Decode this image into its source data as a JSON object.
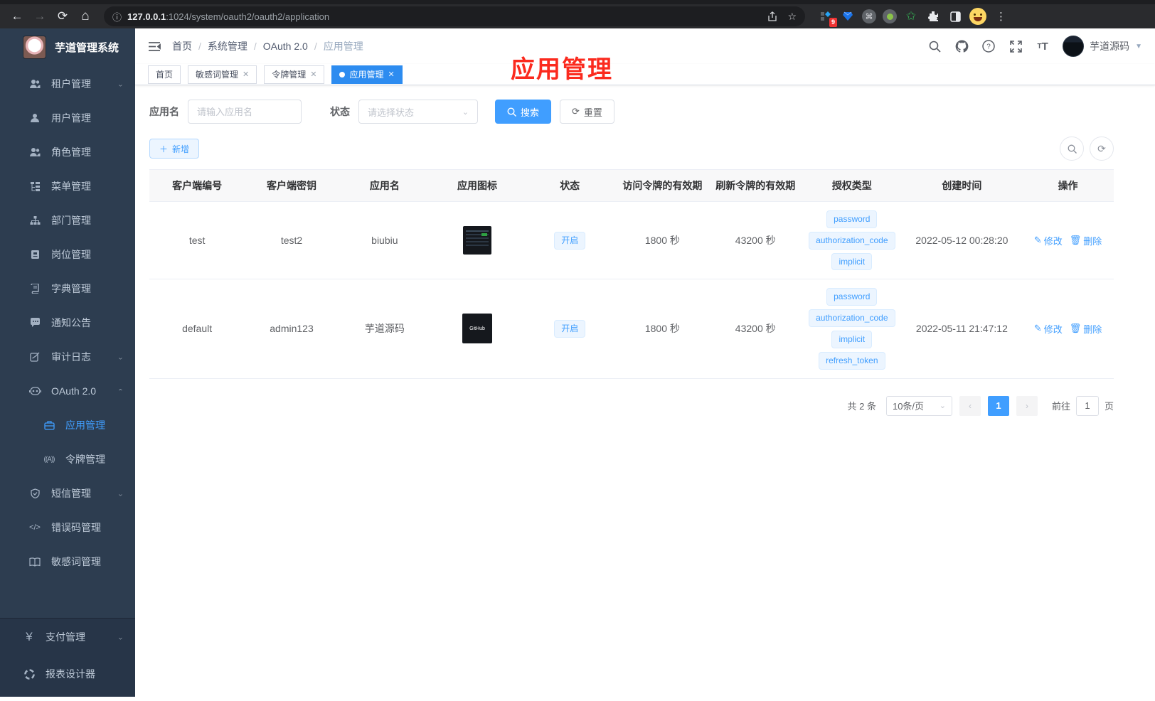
{
  "browser": {
    "url_host": "127.0.0.1",
    "url_rest": ":1024/system/oauth2/oauth2/application",
    "extension_badge": "9"
  },
  "sidebar": {
    "title": "芋道管理系统",
    "items": {
      "tenant": "租户管理",
      "user": "用户管理",
      "role": "角色管理",
      "menu": "菜单管理",
      "dept": "部门管理",
      "post": "岗位管理",
      "dict": "字典管理",
      "notice": "通知公告",
      "audit": "审计日志",
      "oauth": "OAuth 2.0",
      "oauth_app": "应用管理",
      "oauth_token": "令牌管理",
      "sms": "短信管理",
      "errcode": "错误码管理",
      "sensitive": "敏感词管理",
      "pay": "支付管理",
      "report": "报表设计器"
    }
  },
  "header": {
    "breadcrumb": [
      "首页",
      "系统管理",
      "OAuth 2.0",
      "应用管理"
    ],
    "username": "芋道源码"
  },
  "tabs": [
    {
      "label": "首页"
    },
    {
      "label": "敏感词管理"
    },
    {
      "label": "令牌管理"
    },
    {
      "label": "应用管理"
    }
  ],
  "annotation": "应用管理",
  "filters": {
    "app_name_label": "应用名",
    "app_name_placeholder": "请输入应用名",
    "status_label": "状态",
    "status_placeholder": "请选择状态",
    "search_label": "搜索",
    "reset_label": "重置"
  },
  "toolbar": {
    "add_label": "新增"
  },
  "table": {
    "headers": [
      "客户端编号",
      "客户端密钥",
      "应用名",
      "应用图标",
      "状态",
      "访问令牌的有效期",
      "刷新令牌的有效期",
      "授权类型",
      "创建时间",
      "操作"
    ],
    "rows": [
      {
        "client_id": "test",
        "secret": "test2",
        "name": "biubiu",
        "status": "开启",
        "access_validity": "1800 秒",
        "refresh_validity": "43200 秒",
        "grants": [
          "password",
          "authorization_code",
          "implicit"
        ],
        "created": "2022-05-12 00:28:20"
      },
      {
        "client_id": "default",
        "secret": "admin123",
        "name": "芋道源码",
        "status": "开启",
        "access_validity": "1800 秒",
        "refresh_validity": "43200 秒",
        "grants": [
          "password",
          "authorization_code",
          "implicit",
          "refresh_token"
        ],
        "created": "2022-05-11 21:47:12",
        "icon_text": "GitHub"
      }
    ]
  },
  "actions": {
    "edit": "修改",
    "delete": "删除"
  },
  "pagination": {
    "total": "共 2 条",
    "page_size": "10条/页",
    "current_page": "1",
    "goto_label": "前往",
    "goto_value": "1",
    "page_suffix": "页"
  }
}
